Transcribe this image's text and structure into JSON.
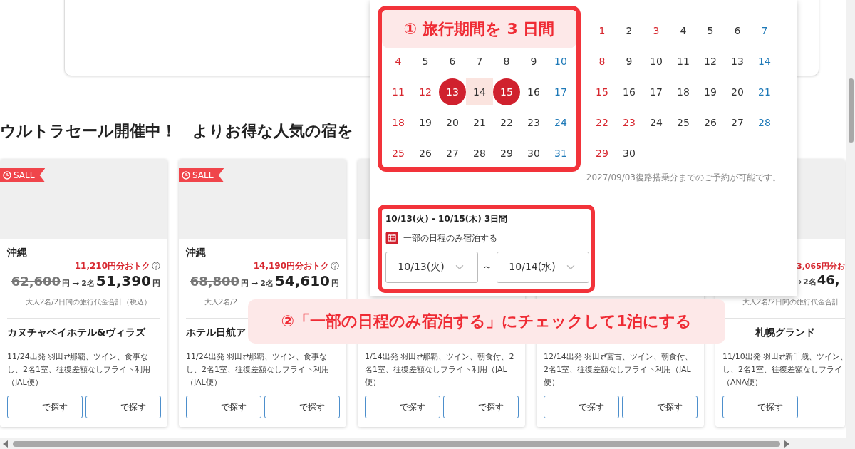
{
  "heading": "ウルトラセール開催中！　よりお得な人気の宿を",
  "cards": [
    {
      "badge": "SALE",
      "region": "沖縄",
      "savings": "11,210円分おトク",
      "savings_help": true,
      "price": {
        "was": "62,600",
        "was_yen": "円",
        "arrow": "→",
        "people": "2名",
        "now": "51,390",
        "now_yen": "円"
      },
      "caption": "大人2名/2日間の旅行代金合計（税込）",
      "hotel": "カヌチャベイホテル&ヴィラズ",
      "description_lines": [
        "11/24出発 羽田⇄那覇、ツイン、食事な",
        "し、2名1室、往復差額なしフライト利用",
        "（JAL便）"
      ],
      "buttons": [
        "で探す",
        "で探す"
      ]
    },
    {
      "badge": "SALE",
      "region": "沖縄",
      "savings": "14,190円分おトク",
      "savings_help": true,
      "price": {
        "was": "68,800",
        "was_yen": "円",
        "arrow": "→",
        "people": "2名",
        "now": "54,610",
        "now_yen": "円"
      },
      "caption": "大人2名/2",
      "hotel": "ホテル日航ア",
      "description_lines": [
        "11/24出発 羽田⇄那覇、ツイン、食事な",
        "し、2名1室、往復差額なしフライト利用",
        "（JAL便）"
      ],
      "buttons": [
        "で探す",
        "で探す"
      ]
    },
    {
      "description_lines": [
        "1/14出発 羽田⇄那覇、ツイン、朝食付、2",
        "名1室、往復差額なしフライト利用（JAL",
        "便）"
      ],
      "buttons": [
        "で探す",
        "で探す"
      ]
    },
    {
      "description_lines": [
        "12/14出発 羽田⇄宮古、ツイン、朝食付、",
        "2名1室、往復差額なしフライト利用（JAL",
        "便）"
      ],
      "buttons": [
        "で探す",
        "で探す"
      ]
    },
    {
      "savings": "3,065円分お",
      "savings_help": false,
      "price": {
        "arrow": "→",
        "people": "2名",
        "now": "46,"
      },
      "caption": "大人2名/2日間の旅行代金合計",
      "hotel": "札幌グランド",
      "description_lines": [
        "11/10出発 羽田⇄新千歳、ツイン、",
        "し、2名1室、往復差額なしフライ",
        "（ANA便）"
      ],
      "buttons": [
        "で探す"
      ]
    }
  ],
  "date_picker": {
    "months": [
      {
        "days": [
          {
            "d": "4",
            "color": "#d7262e",
            "selected": false,
            "in_range": false
          },
          {
            "d": "5",
            "color": "#333333",
            "selected": false,
            "in_range": false
          },
          {
            "d": "6",
            "color": "#333333",
            "selected": false,
            "in_range": false
          },
          {
            "d": "7",
            "color": "#333333",
            "selected": false,
            "in_range": false
          },
          {
            "d": "8",
            "color": "#333333",
            "selected": false,
            "in_range": false
          },
          {
            "d": "9",
            "color": "#333333",
            "selected": false,
            "in_range": false
          },
          {
            "d": "10",
            "color": "#1f7ab8",
            "selected": false,
            "in_range": false
          },
          {
            "d": "11",
            "color": "#d7262e",
            "selected": false,
            "in_range": false
          },
          {
            "d": "12",
            "color": "#d7262e",
            "selected": false,
            "in_range": false
          },
          {
            "d": "13",
            "color": "#d0212e",
            "selected": true,
            "in_range": false
          },
          {
            "d": "14",
            "color": "#333333",
            "selected": false,
            "in_range": true
          },
          {
            "d": "15",
            "color": "#d0212e",
            "selected": true,
            "in_range": false
          },
          {
            "d": "16",
            "color": "#333333",
            "selected": false,
            "in_range": false
          },
          {
            "d": "17",
            "color": "#1f7ab8",
            "selected": false,
            "in_range": false
          },
          {
            "d": "18",
            "color": "#d7262e",
            "selected": false,
            "in_range": false
          },
          {
            "d": "19",
            "color": "#333333",
            "selected": false,
            "in_range": false
          },
          {
            "d": "20",
            "color": "#333333",
            "selected": false,
            "in_range": false
          },
          {
            "d": "21",
            "color": "#333333",
            "selected": false,
            "in_range": false
          },
          {
            "d": "22",
            "color": "#333333",
            "selected": false,
            "in_range": false
          },
          {
            "d": "23",
            "color": "#333333",
            "selected": false,
            "in_range": false
          },
          {
            "d": "24",
            "color": "#1f7ab8",
            "selected": false,
            "in_range": false
          },
          {
            "d": "25",
            "color": "#d7262e",
            "selected": false,
            "in_range": false
          },
          {
            "d": "26",
            "color": "#333333",
            "selected": false,
            "in_range": false
          },
          {
            "d": "27",
            "color": "#333333",
            "selected": false,
            "in_range": false
          },
          {
            "d": "28",
            "color": "#333333",
            "selected": false,
            "in_range": false
          },
          {
            "d": "29",
            "color": "#333333",
            "selected": false,
            "in_range": false
          },
          {
            "d": "30",
            "color": "#333333",
            "selected": false,
            "in_range": false
          },
          {
            "d": "31",
            "color": "#1f7ab8",
            "selected": false,
            "in_range": false
          }
        ]
      },
      {
        "days": [
          {
            "d": "1",
            "color": "#d7262e",
            "selected": false,
            "in_range": false
          },
          {
            "d": "2",
            "color": "#333333",
            "selected": false,
            "in_range": false
          },
          {
            "d": "3",
            "color": "#d7262e",
            "selected": false,
            "in_range": false
          },
          {
            "d": "4",
            "color": "#333333",
            "selected": false,
            "in_range": false
          },
          {
            "d": "5",
            "color": "#333333",
            "selected": false,
            "in_range": false
          },
          {
            "d": "6",
            "color": "#333333",
            "selected": false,
            "in_range": false
          },
          {
            "d": "7",
            "color": "#1f7ab8",
            "selected": false,
            "in_range": false
          },
          {
            "d": "8",
            "color": "#d7262e",
            "selected": false,
            "in_range": false
          },
          {
            "d": "9",
            "color": "#333333",
            "selected": false,
            "in_range": false
          },
          {
            "d": "10",
            "color": "#333333",
            "selected": false,
            "in_range": false
          },
          {
            "d": "11",
            "color": "#333333",
            "selected": false,
            "in_range": false
          },
          {
            "d": "12",
            "color": "#333333",
            "selected": false,
            "in_range": false
          },
          {
            "d": "13",
            "color": "#333333",
            "selected": false,
            "in_range": false
          },
          {
            "d": "14",
            "color": "#1f7ab8",
            "selected": false,
            "in_range": false
          },
          {
            "d": "15",
            "color": "#d7262e",
            "selected": false,
            "in_range": false
          },
          {
            "d": "16",
            "color": "#333333",
            "selected": false,
            "in_range": false
          },
          {
            "d": "17",
            "color": "#333333",
            "selected": false,
            "in_range": false
          },
          {
            "d": "18",
            "color": "#333333",
            "selected": false,
            "in_range": false
          },
          {
            "d": "19",
            "color": "#333333",
            "selected": false,
            "in_range": false
          },
          {
            "d": "20",
            "color": "#333333",
            "selected": false,
            "in_range": false
          },
          {
            "d": "21",
            "color": "#1f7ab8",
            "selected": false,
            "in_range": false
          },
          {
            "d": "22",
            "color": "#d7262e",
            "selected": false,
            "in_range": false
          },
          {
            "d": "23",
            "color": "#d7262e",
            "selected": false,
            "in_range": false
          },
          {
            "d": "24",
            "color": "#333333",
            "selected": false,
            "in_range": false
          },
          {
            "d": "25",
            "color": "#333333",
            "selected": false,
            "in_range": false
          },
          {
            "d": "26",
            "color": "#333333",
            "selected": false,
            "in_range": false
          },
          {
            "d": "27",
            "color": "#333333",
            "selected": false,
            "in_range": false
          },
          {
            "d": "28",
            "color": "#1f7ab8",
            "selected": false,
            "in_range": false
          },
          {
            "d": "29",
            "color": "#d7262e",
            "selected": false,
            "in_range": false
          },
          {
            "d": "30",
            "color": "#333333",
            "selected": false,
            "in_range": false
          }
        ]
      }
    ],
    "note": "2027/09/03復路搭乗分までのご予約が可能です。",
    "range_summary": "10/13(火) - 10/15(木) 3日間",
    "partial_stay": {
      "label": "一部の日程のみ宿泊する",
      "checked": true
    },
    "from_select": "10/13(火)",
    "separator": "～",
    "to_select": "10/14(水)"
  },
  "callouts": {
    "step1": "① 旅行期間を 3 日間",
    "step2": "②「一部の日程のみ宿泊する」にチェックして1泊にする"
  }
}
